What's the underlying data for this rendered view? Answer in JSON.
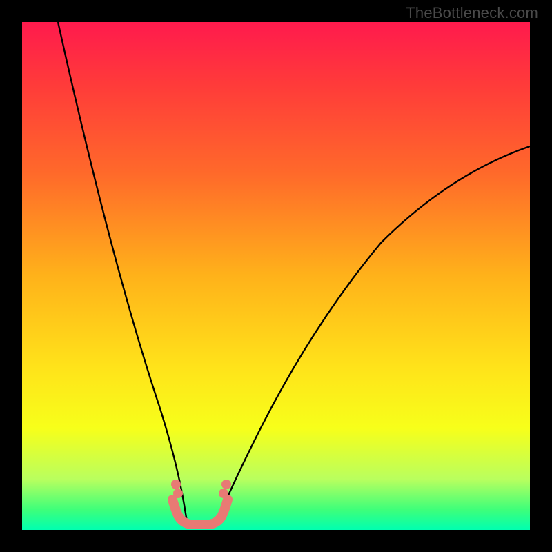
{
  "watermark": {
    "text": "TheBottleneck.com"
  },
  "colors": {
    "curve": "#000000",
    "accent": "#e87a74",
    "background_black": "#000000"
  },
  "chart_data": {
    "type": "line",
    "title": "",
    "xlabel": "",
    "ylabel": "",
    "xlim": [
      0,
      100
    ],
    "ylim": [
      0,
      100
    ],
    "annotations": [
      {
        "text": "TheBottleneck.com",
        "x": 98,
        "y": 1,
        "align": "top-right"
      }
    ],
    "series": [
      {
        "name": "left-curve",
        "x": [
          7,
          10,
          13,
          16,
          19,
          22,
          25,
          27,
          29,
          30.5,
          32
        ],
        "y": [
          100,
          86,
          73,
          60,
          47,
          34,
          22,
          13,
          6,
          2,
          0
        ]
      },
      {
        "name": "right-curve",
        "x": [
          38,
          40,
          43,
          47,
          52,
          58,
          65,
          73,
          82,
          91,
          100
        ],
        "y": [
          0,
          3,
          8,
          16,
          25,
          35,
          45,
          54,
          62,
          69,
          75
        ]
      },
      {
        "name": "floor-accent",
        "x": [
          29,
          30,
          31,
          32,
          33,
          34,
          35,
          36,
          37,
          38,
          39,
          40
        ],
        "y": [
          6,
          3,
          1,
          0,
          0,
          0,
          0,
          0,
          0,
          1,
          3,
          6
        ]
      }
    ]
  }
}
